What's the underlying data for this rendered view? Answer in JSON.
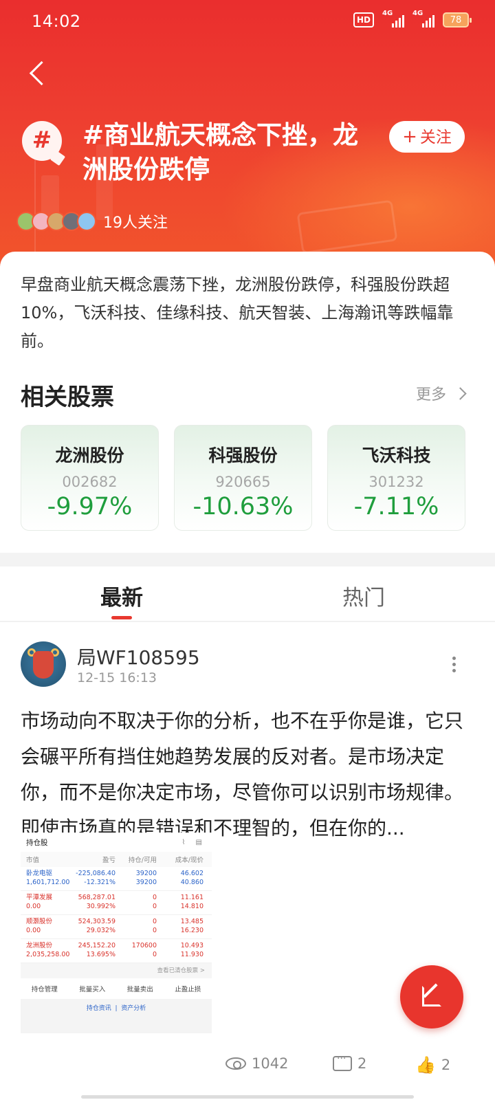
{
  "status": {
    "time": "14:02",
    "hd_label": "HD",
    "net1": "4G",
    "net2": "4G",
    "battery": "78"
  },
  "topic": {
    "icon_glyph": "#",
    "title": "#商业航天概念下挫，龙洲股份跌停",
    "follow_plus": "+",
    "follow_label": "关注",
    "followers_text": "19人关注"
  },
  "description": "早盘商业航天概念震荡下挫，龙洲股份跌停，科强股份跌超10%，飞沃科技、佳缘科技、航天智装、上海瀚讯等跌幅靠前。",
  "related": {
    "title": "相关股票",
    "more_label": "更多",
    "stocks": [
      {
        "name": "龙洲股份",
        "code": "002682",
        "change": "-9.97%"
      },
      {
        "name": "科强股份",
        "code": "920665",
        "change": "-10.63%"
      },
      {
        "name": "飞沃科技",
        "code": "301232",
        "change": "-7.11%"
      }
    ]
  },
  "tabs": [
    {
      "label": "最新"
    },
    {
      "label": "热门"
    }
  ],
  "post": {
    "username": "局WF108595",
    "time": "12-15 16:13",
    "text": "市场动向不取决于你的分析，也不在乎你是谁，它只会碾平所有挡住她趋势发展的反对者。是市场决定你，而不是你决定市场，尽管你可以识别市场规律。即使市场真的是错误和不理智的，但在你的...",
    "screenshot": {
      "title": "持仓股",
      "columns": [
        "市值",
        "盈亏",
        "持仓/可用",
        "成本/现价"
      ],
      "rows": [
        {
          "c1a": "卧龙电驱",
          "c1b": "1,601,712.00",
          "c2a": "-225,086.40",
          "c2b": "-12.321%",
          "c3a": "39200",
          "c3b": "39200",
          "c4a": "46.602",
          "c4b": "40.860"
        },
        {
          "c1a": "平潭发展",
          "c1b": "0.00",
          "c2a": "568,287.01",
          "c2b": "30.992%",
          "c3a": "0",
          "c3b": "0",
          "c4a": "11.161",
          "c4b": "14.810"
        },
        {
          "c1a": "顺灏股份",
          "c1b": "0.00",
          "c2a": "524,303.59",
          "c2b": "29.032%",
          "c3a": "0",
          "c3b": "0",
          "c4a": "13.485",
          "c4b": "16.230"
        },
        {
          "c1a": "龙洲股份",
          "c1b": "2,035,258.00",
          "c2a": "245,152.20",
          "c2b": "13.695%",
          "c3a": "170600",
          "c3b": "0",
          "c4a": "10.493",
          "c4b": "11.930"
        }
      ],
      "cleared_link": "查看已清仓股票 >",
      "actions": [
        "持仓管理",
        "批量买入",
        "批量卖出",
        "止盈止损"
      ],
      "links": [
        "持仓资讯",
        "资产分析"
      ]
    },
    "views": "1042",
    "comments": "2",
    "likes": "2"
  }
}
